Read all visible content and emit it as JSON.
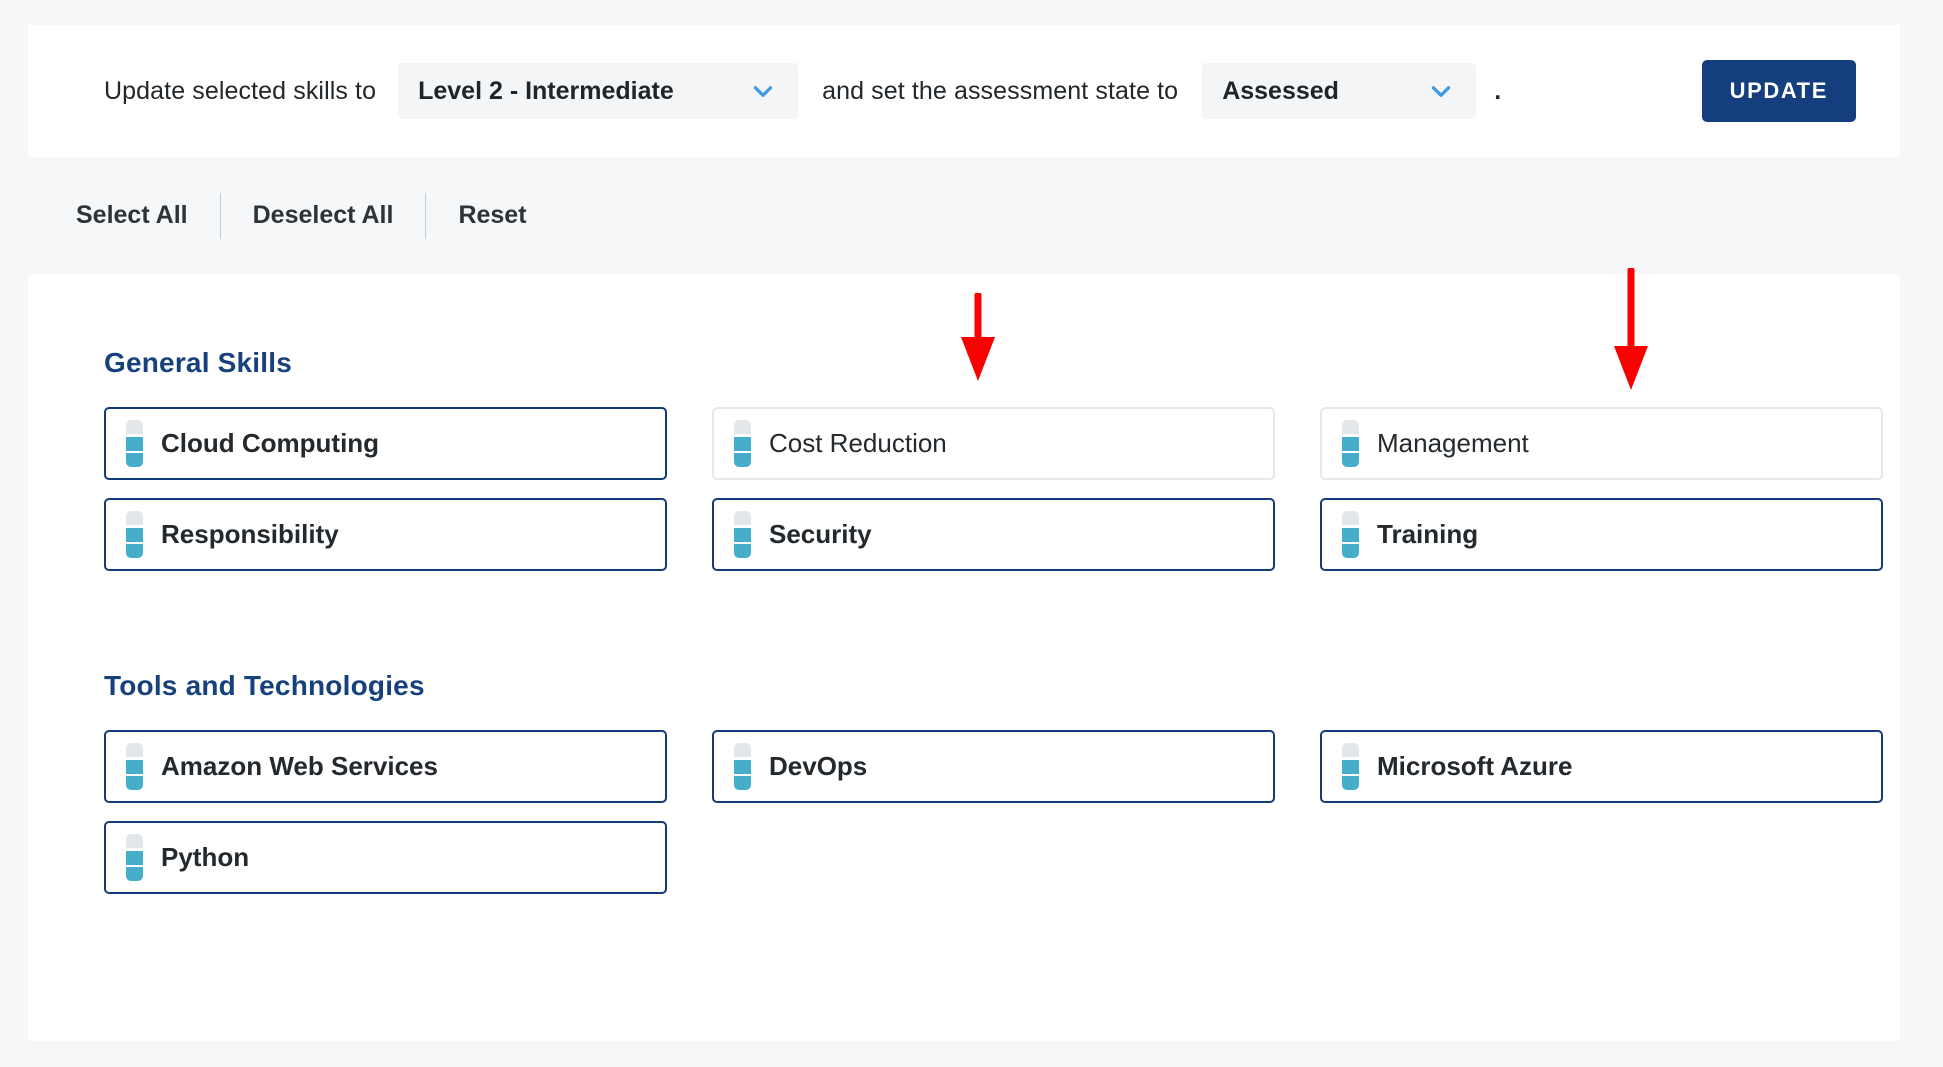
{
  "action_bar": {
    "lead_text": "Update selected skills to",
    "level_dropdown": {
      "value": "Level 2 - Intermediate",
      "chevron_icon": "chevron-down-icon"
    },
    "mid_text": "and set the assessment state to",
    "state_dropdown": {
      "value": "Assessed",
      "chevron_icon": "chevron-down-icon"
    },
    "trailing_punctuation": ".",
    "update_label": "UPDATE"
  },
  "toolbar": {
    "select_all": "Select All",
    "deselect_all": "Deselect All",
    "reset": "Reset"
  },
  "sections": [
    {
      "title": "General Skills",
      "skills": [
        {
          "label": "Cloud Computing",
          "selected": true,
          "level": 2
        },
        {
          "label": "Cost Reduction",
          "selected": false,
          "level": 2
        },
        {
          "label": "Management",
          "selected": false,
          "level": 2
        },
        {
          "label": "Responsibility",
          "selected": true,
          "level": 2
        },
        {
          "label": "Security",
          "selected": true,
          "level": 2
        },
        {
          "label": "Training",
          "selected": true,
          "level": 2
        }
      ]
    },
    {
      "title": "Tools and Technologies",
      "skills": [
        {
          "label": "Amazon Web Services",
          "selected": true,
          "level": 2
        },
        {
          "label": "DevOps",
          "selected": true,
          "level": 2
        },
        {
          "label": "Microsoft Azure",
          "selected": true,
          "level": 2
        },
        {
          "label": "Python",
          "selected": true,
          "level": 2
        }
      ]
    }
  ],
  "annotations": [
    {
      "name": "arrow-pointing-to-cost-reduction",
      "icon": "down-arrow-icon",
      "color": "#fb0000"
    },
    {
      "name": "arrow-pointing-to-management",
      "icon": "down-arrow-icon",
      "color": "#fb0000"
    }
  ],
  "colors": {
    "brand_navy": "#153e7e",
    "section_heading": "#16417c",
    "meter_filled": "#46adca",
    "meter_empty": "#e4e7ea",
    "chevron_blue": "#3c9ae6",
    "annotation_red": "#fb0000",
    "page_background": "#f6f7f8"
  }
}
